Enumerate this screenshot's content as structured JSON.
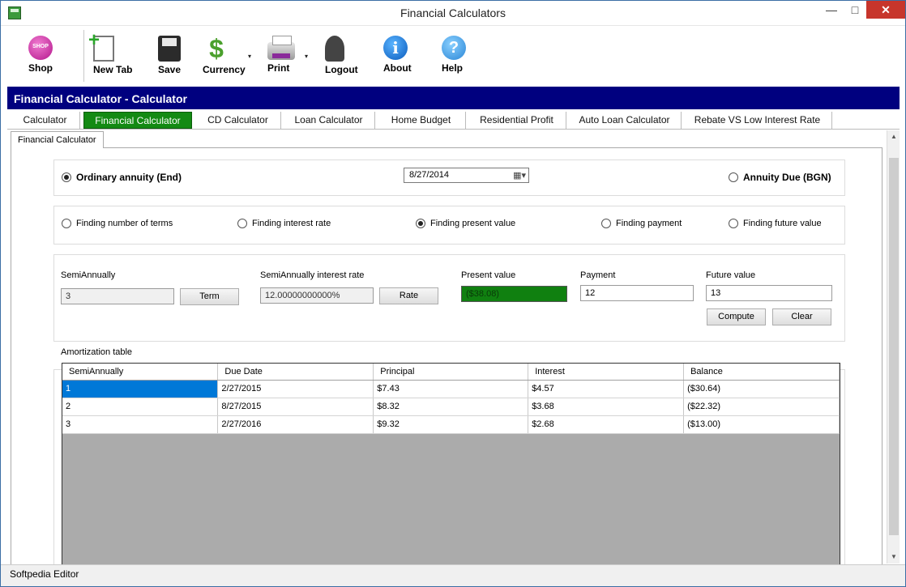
{
  "window": {
    "title": "Financial Calculators"
  },
  "window_controls": {
    "minimize": "—",
    "maximize": "□",
    "close": "✕"
  },
  "toolbar": {
    "shop": "Shop",
    "new_tab": "New Tab",
    "save": "Save",
    "currency": "Currency",
    "print": "Print",
    "logout": "Logout",
    "about": "About",
    "help": "Help",
    "about_glyph": "i",
    "help_glyph": "?",
    "currency_glyph": "$",
    "caret": "▾"
  },
  "header": {
    "title": "Financial Calculator - Calculator"
  },
  "tabs": [
    {
      "label": "Calculator"
    },
    {
      "label": "Financial Calculator"
    },
    {
      "label": "CD Calculator"
    },
    {
      "label": "Loan Calculator"
    },
    {
      "label": "Home Budget"
    },
    {
      "label": "Residential Profit"
    },
    {
      "label": "Auto Loan Calculator"
    },
    {
      "label": "Rebate VS Low Interest Rate"
    }
  ],
  "subtab": {
    "label": "Financial Calculator"
  },
  "annuity": {
    "ordinary_label": "Ordinary annuity (End)",
    "due_label": "Annuity Due (BGN)",
    "selected": "ordinary",
    "date": "8/27/2014"
  },
  "finding": {
    "options": [
      {
        "label": "Finding number of terms"
      },
      {
        "label": "Finding interest rate"
      },
      {
        "label": "Finding present value"
      },
      {
        "label": "Finding payment"
      },
      {
        "label": "Finding future value"
      }
    ],
    "selected": "Finding present value"
  },
  "inputs": {
    "terms_label": "SemiAnnually",
    "terms_value": "3",
    "term_button": "Term",
    "rate_label": "SemiAnnually interest rate",
    "rate_value": "12.00000000000%",
    "rate_button": "Rate",
    "pv_label": "Present value",
    "pv_value": "($38.08)",
    "payment_label": "Payment",
    "payment_value": "12",
    "fv_label": "Future value",
    "fv_value": "13",
    "compute_button": "Compute",
    "clear_button": "Clear"
  },
  "amortization": {
    "title": "Amortization table",
    "columns": [
      "SemiAnnually",
      "Due Date",
      "Principal",
      "Interest",
      "Balance"
    ],
    "rows": [
      [
        "1",
        "2/27/2015",
        "$7.43",
        "$4.57",
        "($30.64)"
      ],
      [
        "2",
        "8/27/2015",
        "$8.32",
        "$3.68",
        "($22.32)"
      ],
      [
        "3",
        "2/27/2016",
        "$9.32",
        "$2.68",
        "($13.00)"
      ]
    ]
  },
  "status": {
    "text": "Softpedia Editor"
  }
}
